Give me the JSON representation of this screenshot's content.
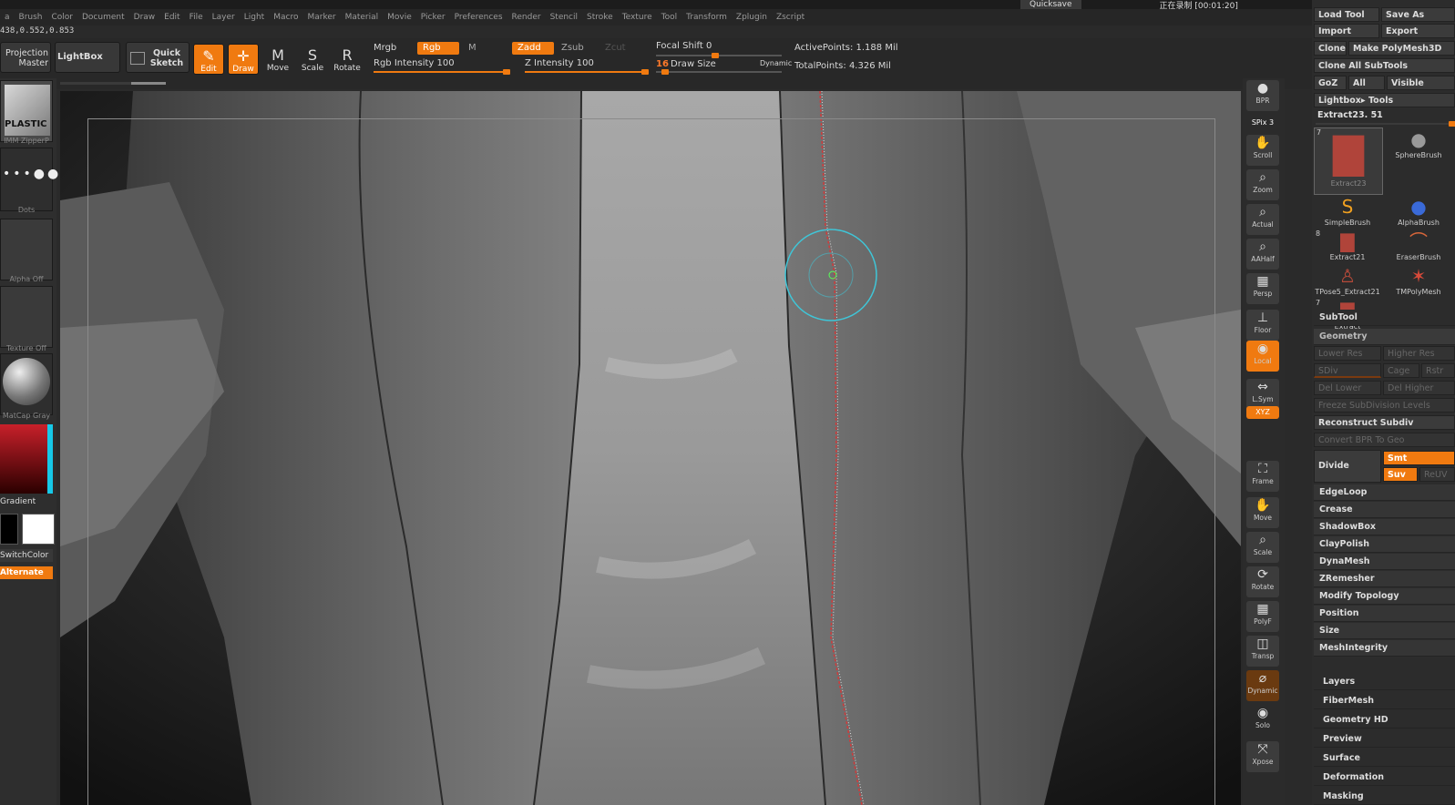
{
  "menu": [
    "a",
    "Brush",
    "Color",
    "Document",
    "Draw",
    "Edit",
    "File",
    "Layer",
    "Light",
    "Macro",
    "Marker",
    "Material",
    "Movie",
    "Picker",
    "Preferences",
    "Render",
    "Stencil",
    "Stroke",
    "Texture",
    "Tool",
    "Transform",
    "Zplugin",
    "Zscript"
  ],
  "coords": "438,0.552,0.853",
  "recorder": {
    "quicksave": "Quicksave",
    "status": "正在录制 [00:01:20]"
  },
  "toolbar": {
    "projection": "Projection Master",
    "lightbox": "LightBox",
    "quicksketch": "Quick Sketch",
    "edit": "Edit",
    "draw": "Draw",
    "move": "Move",
    "scale": "Scale",
    "rotate": "Rotate",
    "mrgb": "Mrgb",
    "rgb": "Rgb",
    "m": "M",
    "zadd": "Zadd",
    "zsub": "Zsub",
    "zcut": "Zcut",
    "rgb_intensity": "Rgb Intensity 100",
    "z_intensity": "Z Intensity 100",
    "focal_shift": "Focal Shift 0",
    "draw_size_value": "16",
    "draw_size": "Draw Size",
    "dynamic": "Dynamic",
    "active_points": "ActivePoints: 1.188 Mil",
    "total_points": "TotalPoints: 4.326 Mil",
    "rgb_intensity_level": 1.0,
    "z_intensity_level": 1.0,
    "focal_shift_level": 0.5,
    "draw_size_level": 0.1
  },
  "left": {
    "brush": "IMM ZipperP",
    "brush_icon_text": "PLASTIC",
    "stroke": "Dots",
    "alpha": "Alpha Off",
    "texture": "Texture Off",
    "material": "MatCap Gray",
    "gradient": "Gradient",
    "switch_color": "SwitchColor",
    "alternate": "Alternate"
  },
  "right_shelf": [
    "BPR",
    "SPix 3",
    "Scroll",
    "Zoom",
    "Actual",
    "AAHalf",
    "Persp",
    "Floor",
    "Local",
    "L.Sym",
    "XYZ",
    "Frame",
    "Move",
    "Scale",
    "Rotate",
    "PolyF",
    "Transp",
    "Dynamic",
    "Solo",
    "Xpose"
  ],
  "palette": {
    "load_tool": "Load Tool",
    "save_as": "Save As",
    "import": "Import",
    "export": "Export",
    "clone": "Clone",
    "make_polymesh": "Make PolyMesh3D",
    "clone_all": "Clone All SubTools",
    "goz": "GoZ",
    "all": "All",
    "visible": "Visible",
    "lightbox_tools": "Lightbox▸ Tools",
    "current_tool": "Extract23. 51",
    "tools": [
      {
        "name": "Extract23",
        "badge": "7",
        "icon": "torso-red-icon"
      },
      {
        "name": "SphereBrush",
        "badge": "",
        "icon": "sphere-gray-icon"
      },
      {
        "name": "SimpleBrush",
        "badge": "",
        "icon": "s-brush-icon"
      },
      {
        "name": "AlphaBrush",
        "badge": "",
        "icon": "sphere-blue-icon"
      },
      {
        "name": "Extract21",
        "badge": "8",
        "icon": "torso-red-icon"
      },
      {
        "name": "EraserBrush",
        "badge": "",
        "icon": "eraser-brush-icon"
      },
      {
        "name": "TPose5_Extract21",
        "badge": "",
        "icon": "figure-red-icon"
      },
      {
        "name": "TMPolyMesh",
        "badge": "",
        "icon": "star-red-icon"
      },
      {
        "name": "Extract",
        "badge": "7",
        "icon": "torso-red-icon"
      }
    ],
    "subtool": "SubTool",
    "geometry": "Geometry",
    "lower_res": "Lower Res",
    "higher_res": "Higher Res",
    "sdiv": "SDiv",
    "cage": "Cage",
    "rstr": "Rstr",
    "del_lower": "Del Lower",
    "del_higher": "Del Higher",
    "freeze_subdiv": "Freeze SubDivision Levels",
    "reconstruct": "Reconstruct Subdiv",
    "convert_bpr": "Convert BPR To Geo",
    "divide": "Divide",
    "smt": "Smt",
    "suv": "Suv",
    "rel": "ReUV",
    "geometry_items": [
      "EdgeLoop",
      "Crease",
      "ShadowBox",
      "ClayPolish",
      "DynaMesh",
      "ZRemesher",
      "Modify Topology",
      "Position",
      "Size",
      "MeshIntegrity"
    ],
    "sections": [
      "Layers",
      "FiberMesh",
      "Geometry HD",
      "Preview",
      "Surface",
      "Deformation",
      "Masking"
    ]
  },
  "colors": {
    "accent": "#f07a10",
    "panel": "#2c2c2c",
    "brush_ring": "#3fc6d8",
    "seam": "#d23a3a"
  }
}
